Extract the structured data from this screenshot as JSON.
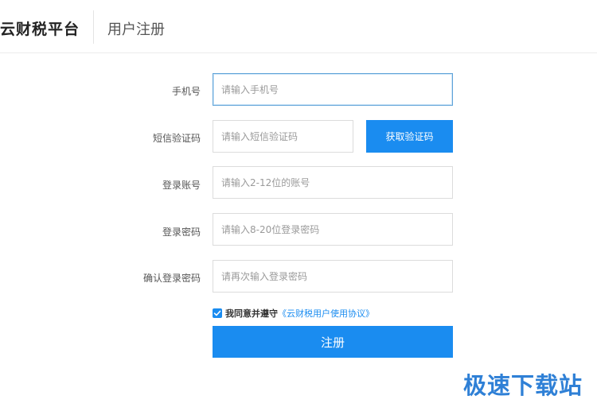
{
  "header": {
    "brand": "云财税平台",
    "title": "用户注册"
  },
  "form": {
    "phone": {
      "label": "手机号",
      "placeholder": "请输入手机号",
      "value": ""
    },
    "sms_code": {
      "label": "短信验证码",
      "placeholder": "请输入短信验证码",
      "value": "",
      "button_label": "获取验证码"
    },
    "account": {
      "label": "登录账号",
      "placeholder": "请输入2-12位的账号",
      "value": ""
    },
    "password": {
      "label": "登录密码",
      "placeholder": "请输入8-20位登录密码",
      "value": ""
    },
    "confirm_password": {
      "label": "确认登录密码",
      "placeholder": "请再次输入登录密码",
      "value": ""
    },
    "agreement": {
      "checked": true,
      "prefix": "我同意并遵守",
      "link_text": "《云财税用户使用协议》"
    },
    "submit_label": "注册"
  },
  "watermark": "极速下载站",
  "colors": {
    "accent": "#1a8cf0",
    "focus_border": "#5fa3d8",
    "watermark": "#2f80d6"
  }
}
